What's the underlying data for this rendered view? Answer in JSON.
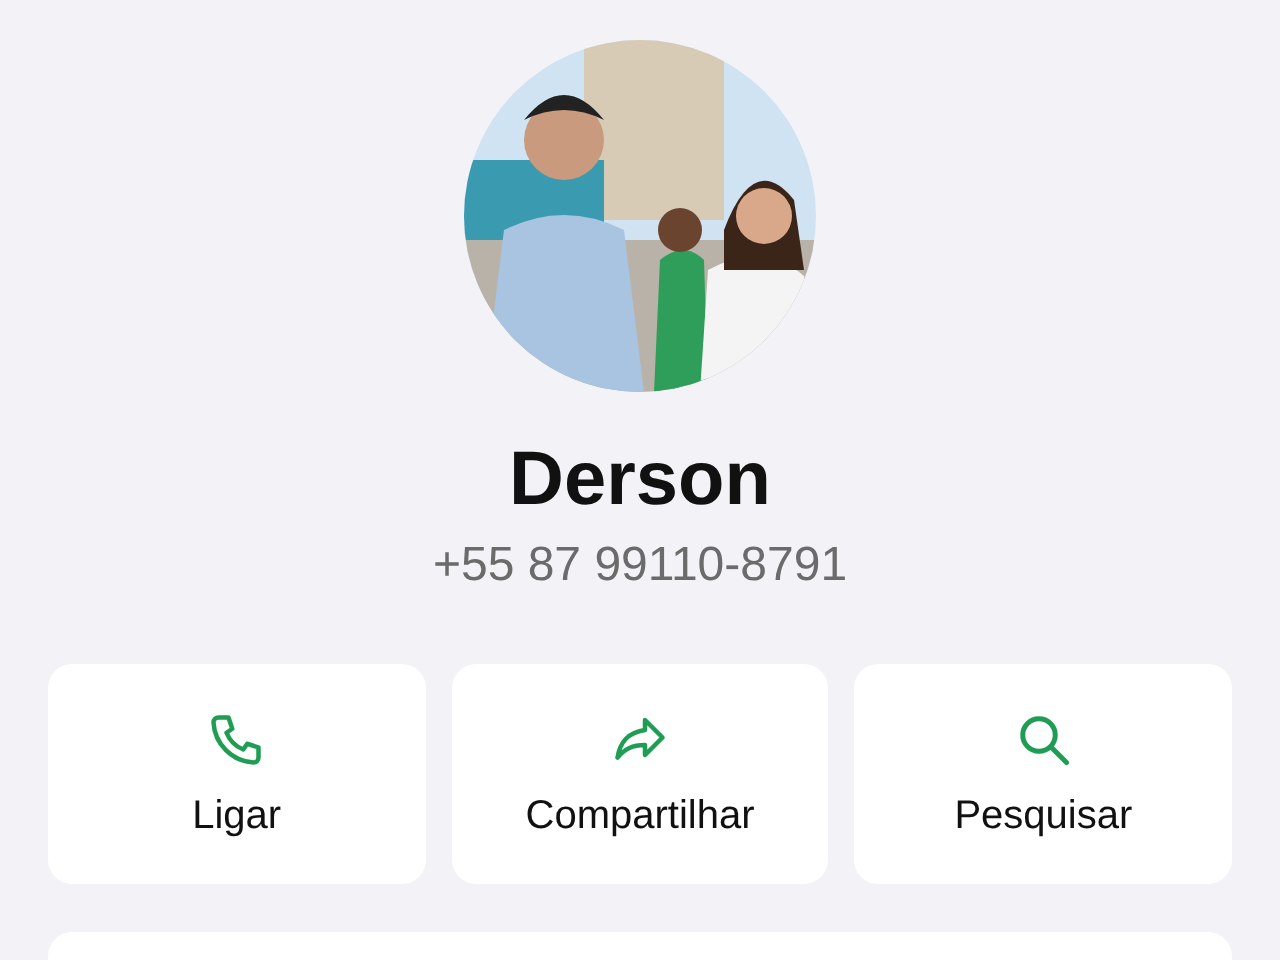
{
  "contact": {
    "name": "Derson",
    "phone": "+55 87 99110-8791"
  },
  "actions": [
    {
      "kind": "call",
      "label": "Ligar"
    },
    {
      "kind": "share",
      "label": "Compartilhar"
    },
    {
      "kind": "search",
      "label": "Pesquisar"
    }
  ]
}
